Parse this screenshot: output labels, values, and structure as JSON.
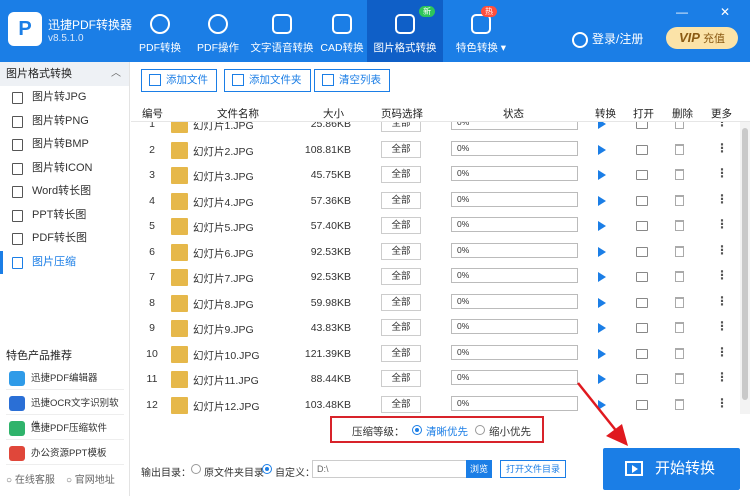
{
  "app": {
    "name": "迅捷PDF转换器",
    "version": "v8.5.1.0",
    "logo_letter": "P"
  },
  "nav": [
    {
      "label": "PDF转换",
      "icon": "refresh-icon"
    },
    {
      "label": "PDF操作",
      "icon": "settings-icon"
    },
    {
      "label": "文字语音转换",
      "icon": "audio-icon"
    },
    {
      "label": "CAD转换",
      "icon": "cad-icon"
    },
    {
      "label": "图片格式转换",
      "icon": "image-icon",
      "badge": "新"
    },
    {
      "label": "特色转换 ▾",
      "icon": "star-icon",
      "badge": "热"
    }
  ],
  "window": {
    "minimize": "—",
    "close": "✕"
  },
  "account": {
    "login": "登录/注册",
    "vip": "VIP",
    "vip_sub": "充值"
  },
  "sidebar": {
    "section_title": "图片格式转换",
    "items": [
      "图片转JPG",
      "图片转PNG",
      "图片转BMP",
      "图片转ICON",
      "Word转长图",
      "PPT转长图",
      "PDF转长图",
      "图片压缩"
    ],
    "active_index": 7,
    "featured_title": "特色产品推荐",
    "featured": [
      {
        "label": "迅捷PDF编辑器",
        "color": "#2f9be8"
      },
      {
        "label": "迅捷OCR文字识别软件",
        "color": "#2a6fd6"
      },
      {
        "label": "迅捷PDF压缩软件",
        "color": "#2fb36b"
      },
      {
        "label": "办公资源PPT模板",
        "color": "#e0473a"
      }
    ],
    "footer": {
      "service": "在线客服",
      "website": "官网地址"
    }
  },
  "toolbar": {
    "add_file": "添加文件",
    "add_folder": "添加文件夹",
    "clear_list": "清空列表"
  },
  "table": {
    "headers": [
      "编号",
      "文件名称",
      "大小",
      "页码选择",
      "状态",
      "转换",
      "打开",
      "删除",
      "更多"
    ],
    "rows": [
      {
        "no": "1",
        "name": "幻灯片1.JPG",
        "size": "25.86KB"
      },
      {
        "no": "2",
        "name": "幻灯片2.JPG",
        "size": "108.81KB"
      },
      {
        "no": "3",
        "name": "幻灯片3.JPG",
        "size": "45.75KB"
      },
      {
        "no": "4",
        "name": "幻灯片4.JPG",
        "size": "57.36KB"
      },
      {
        "no": "5",
        "name": "幻灯片5.JPG",
        "size": "57.40KB"
      },
      {
        "no": "6",
        "name": "幻灯片6.JPG",
        "size": "92.53KB"
      },
      {
        "no": "7",
        "name": "幻灯片7.JPG",
        "size": "92.53KB"
      },
      {
        "no": "8",
        "name": "幻灯片8.JPG",
        "size": "59.98KB"
      },
      {
        "no": "9",
        "name": "幻灯片9.JPG",
        "size": "43.83KB"
      },
      {
        "no": "10",
        "name": "幻灯片10.JPG",
        "size": "121.39KB"
      },
      {
        "no": "11",
        "name": "幻灯片11.JPG",
        "size": "88.44KB"
      },
      {
        "no": "12",
        "name": "幻灯片12.JPG",
        "size": "103.48KB"
      }
    ],
    "page_label": "全部",
    "progress_text": "0%",
    "more_glyph": "⋮"
  },
  "compress": {
    "label": "压缩等级：",
    "option_clear": "清晰优先",
    "option_small": "缩小优先",
    "selected": "清晰优先"
  },
  "output": {
    "label": "输出目录：",
    "opt_original": "原文件夹目录",
    "opt_custom": "自定义：",
    "path": "D:\\",
    "browse": "浏览",
    "open_folder": "打开文件目录"
  },
  "start_button": "开始转换",
  "colors": {
    "brand": "#1b7ee6",
    "highlight_box": "#d8232a",
    "arrow": "#e0191f"
  }
}
